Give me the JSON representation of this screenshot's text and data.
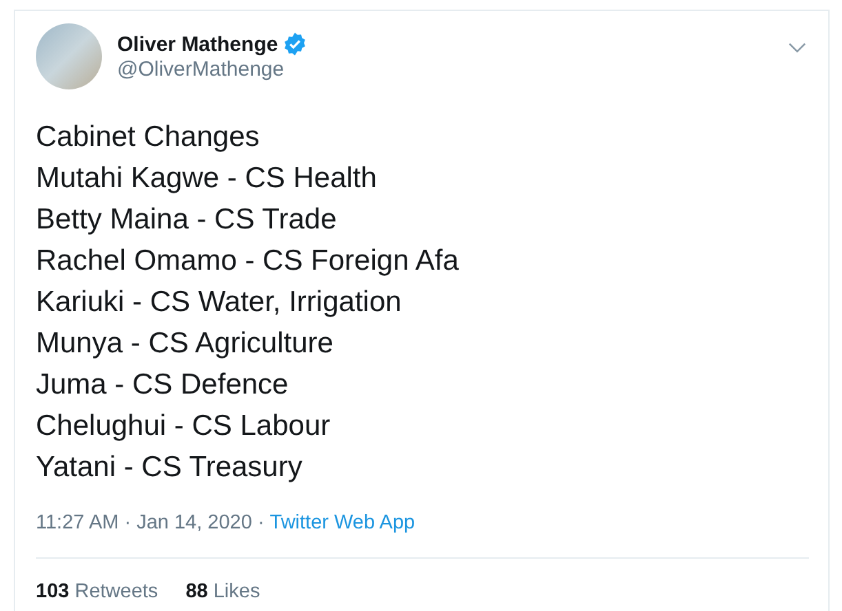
{
  "author": {
    "name": "Oliver Mathenge",
    "verified": true,
    "handle": "@OliverMathenge"
  },
  "tweet_lines": [
    "Cabinet Changes",
    "Mutahi Kagwe - CS Health",
    "Betty Maina - CS Trade",
    "Rachel Omamo - CS Foreign Afa",
    "Kariuki - CS Water, Irrigation",
    "Munya - CS Agriculture",
    "Juma - CS Defence",
    "Chelughui - CS Labour",
    "Yatani - CS Treasury"
  ],
  "timestamp": "11:27 AM · Jan 14, 2020 ·",
  "source": "Twitter Web App",
  "stats": [
    "**103** Retweets",
    "**88** Likes"
  ]
}
